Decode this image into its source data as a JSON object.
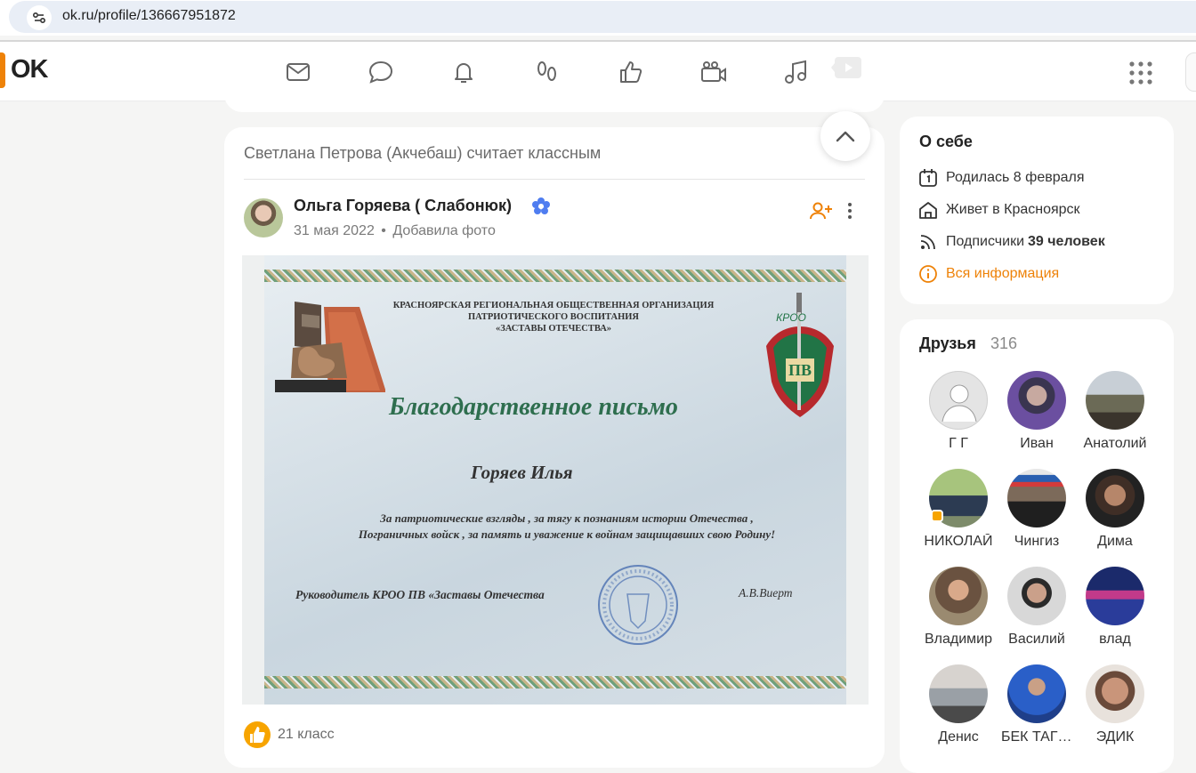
{
  "browser": {
    "url": "ok.ru/profile/136667951872"
  },
  "brand": {
    "logo_text": "OK",
    "accent_color": "#ee8208"
  },
  "topnav": {
    "icons": [
      "mail-icon",
      "chat-icon",
      "bell-icon",
      "footprints-icon",
      "thumbs-up-icon",
      "video-camera-icon",
      "music-note-icon",
      "play-icon",
      "apps-grid-icon"
    ]
  },
  "feed": {
    "activity_text": "Светлана Петрова (Акчебаш) считает классным",
    "post": {
      "author": "Ольга Горяева ( Слабонюк)",
      "date": "31 мая 2022",
      "separator": "•",
      "action": "Добавила фото",
      "likes": "21 класс",
      "photo": {
        "org_line1": "КРАСНОЯРСКАЯ РЕГИОНАЛЬНАЯ ОБЩЕСТВЕННАЯ ОРГАНИЗАЦИЯ",
        "org_line2": "ПАТРИОТИЧЕСКОГО ВОСПИТАНИЯ",
        "org_line3": "«ЗАСТАВЫ ОТЕЧЕСТВА»",
        "title": "Благодарственное письмо",
        "recipient": "Горяев Илья",
        "body_line1": "За патриотические взгляды , за тягу к познаниям истории Отечества ,",
        "body_line2": "Пограничных войск , за память и уважение к войнам защищавших свою Родину!",
        "signature_role": "Руководитель КРОО ПВ «Заставы Отечества",
        "signature_name": "А.В.Виерт",
        "emblem_top": "КРОО",
        "emblem_letters": "ПВ"
      }
    }
  },
  "about": {
    "title": "О себе",
    "birthday": "Родилась 8 февраля",
    "city": "Живет в Красноярск",
    "followers_label": "Подписчики",
    "followers_value": "39 человек",
    "all_info": "Вся информация"
  },
  "friends": {
    "title": "Друзья",
    "count": "316",
    "items": [
      {
        "name": "Г Г"
      },
      {
        "name": "Иван"
      },
      {
        "name": "Анатолий"
      },
      {
        "name": "НИКОЛАЙ"
      },
      {
        "name": "Чингиз"
      },
      {
        "name": "Дима"
      },
      {
        "name": "Владимир"
      },
      {
        "name": "Василий"
      },
      {
        "name": "влад"
      },
      {
        "name": "Денис"
      },
      {
        "name": "БЕК ТАГИЕВ"
      },
      {
        "name": "ЭДИК"
      }
    ]
  }
}
